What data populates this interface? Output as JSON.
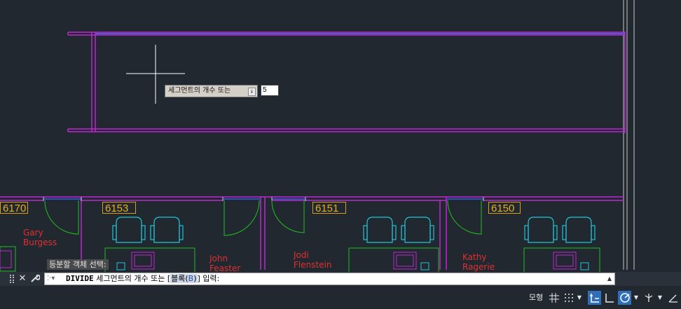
{
  "rooms": [
    {
      "number": "6170"
    },
    {
      "number": "6153"
    },
    {
      "number": "6151"
    },
    {
      "number": "6150"
    }
  ],
  "people": [
    {
      "first": "Gary",
      "last": "Burgess"
    },
    {
      "first": "John",
      "last": "Feaster"
    },
    {
      "first": "Jodi",
      "last": "Flenstein"
    },
    {
      "first": "Kathy",
      "last": "Ragerie"
    }
  ],
  "dynamic_input": {
    "prompt": "세그먼트의 개수 또는",
    "dropdown_icon": "down-arrow-icon",
    "value": "5"
  },
  "command_history": "등분할 객체 선택:",
  "command_line": {
    "prefix": "⁚·▾",
    "command": "DIVIDE",
    "text_before": " 세그먼트의 개수 또는 [",
    "option": "블록(",
    "option_key": "B",
    "option_end": ")",
    "text_after": "] 입력:",
    "scroll_icon": "▲"
  },
  "command_bar": {
    "close_icon": "✕",
    "customize_icon": "🔧"
  },
  "status_bar": {
    "model_label": "모형",
    "buttons": [
      "grid-icon",
      "snap-icon",
      "snap-dropdown-icon",
      "infer-constraints-icon",
      "ortho-icon",
      "polar-icon",
      "polar-dropdown-icon",
      "isodraft-icon",
      "isodraft-dropdown-icon",
      "object-snap-tracking-icon"
    ]
  },
  "colors": {
    "background": "#212830",
    "walls": "#c026d3",
    "room_label": "#e8b020",
    "person_text": "#e03030",
    "furniture": "#22c4d8",
    "desk": "#20c020",
    "door": "#20c020",
    "window": "#3050c0"
  }
}
